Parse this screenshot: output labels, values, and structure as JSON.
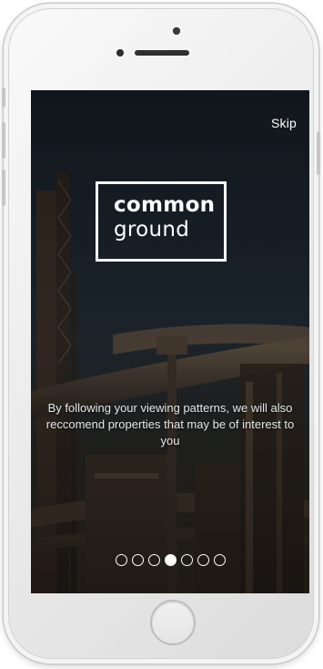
{
  "onboarding": {
    "skip_label": "Skip",
    "logo": {
      "line1": "common",
      "line2": "ground"
    },
    "caption": "By following your viewing patterns, we will also reccomend properties that may be of interest to you",
    "pagination": {
      "total": 7,
      "active_index": 3
    }
  },
  "colors": {
    "text": "#ffffff",
    "overlay": "#1b232c"
  }
}
